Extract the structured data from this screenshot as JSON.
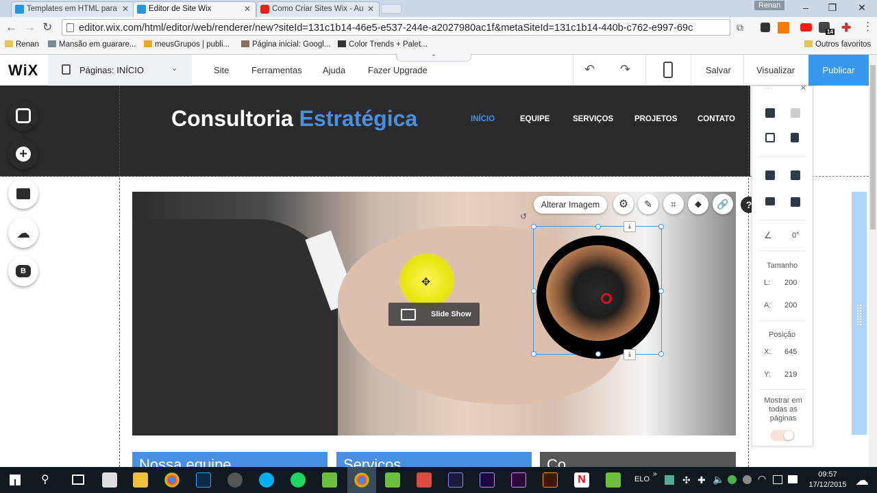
{
  "browser": {
    "tabs": [
      {
        "title": "Templates em HTML para",
        "active": false
      },
      {
        "title": "Editor de Site Wix",
        "active": true
      },
      {
        "title": "Como Criar Sites Wix - Au",
        "active": false
      }
    ],
    "user": "Renan",
    "url": "editor.wix.com/html/editor/web/renderer/new?siteId=131c1b14-46e5-e537-244e-a2027980ac1f&metaSiteId=131c1b14-440b-c762-e997-69c",
    "bookmarks": [
      "Renan",
      "Mansão em guarare...",
      "meusGrupos | publi...",
      "Página inicial: Googl...",
      "Color Trends + Palet..."
    ],
    "other_bookmarks": "Outros favoritos",
    "ext_badge": "14"
  },
  "editor": {
    "logo": "WiX",
    "pages_label": "Páginas: INÍCIO",
    "menu": [
      "Site",
      "Ferramentas",
      "Ajuda",
      "Fazer Upgrade"
    ],
    "save": "Salvar",
    "preview": "Visualizar",
    "publish": "Publicar"
  },
  "site": {
    "title_part1": "Consultoria",
    "title_part2": "Estratégica",
    "nav": [
      "INÍCIO",
      "EQUIPE",
      "SERVIÇOS",
      "PROJETOS",
      "CONTATO"
    ],
    "slideshow_label": "Slide Show",
    "change_image": "Alterar Imagem",
    "bands": [
      "Nossa equipe",
      "Serviços",
      "Co..."
    ],
    "help": "?"
  },
  "panel": {
    "rotation": "0°",
    "size_title": "Tamanho",
    "width_label": "L:",
    "width": "200",
    "height_label": "A:",
    "height": "200",
    "position_title": "Posição",
    "x_label": "X:",
    "x": "645",
    "y_label": "Y:",
    "y": "219",
    "show_all": "Mostrar em todas as páginas"
  },
  "taskbar": {
    "lang": "ELO",
    "time": "09:57",
    "date": "17/12/2015"
  },
  "colors": {
    "accent": "#4a90e2",
    "publish": "#3899ec",
    "header": "#2a2a2c"
  }
}
